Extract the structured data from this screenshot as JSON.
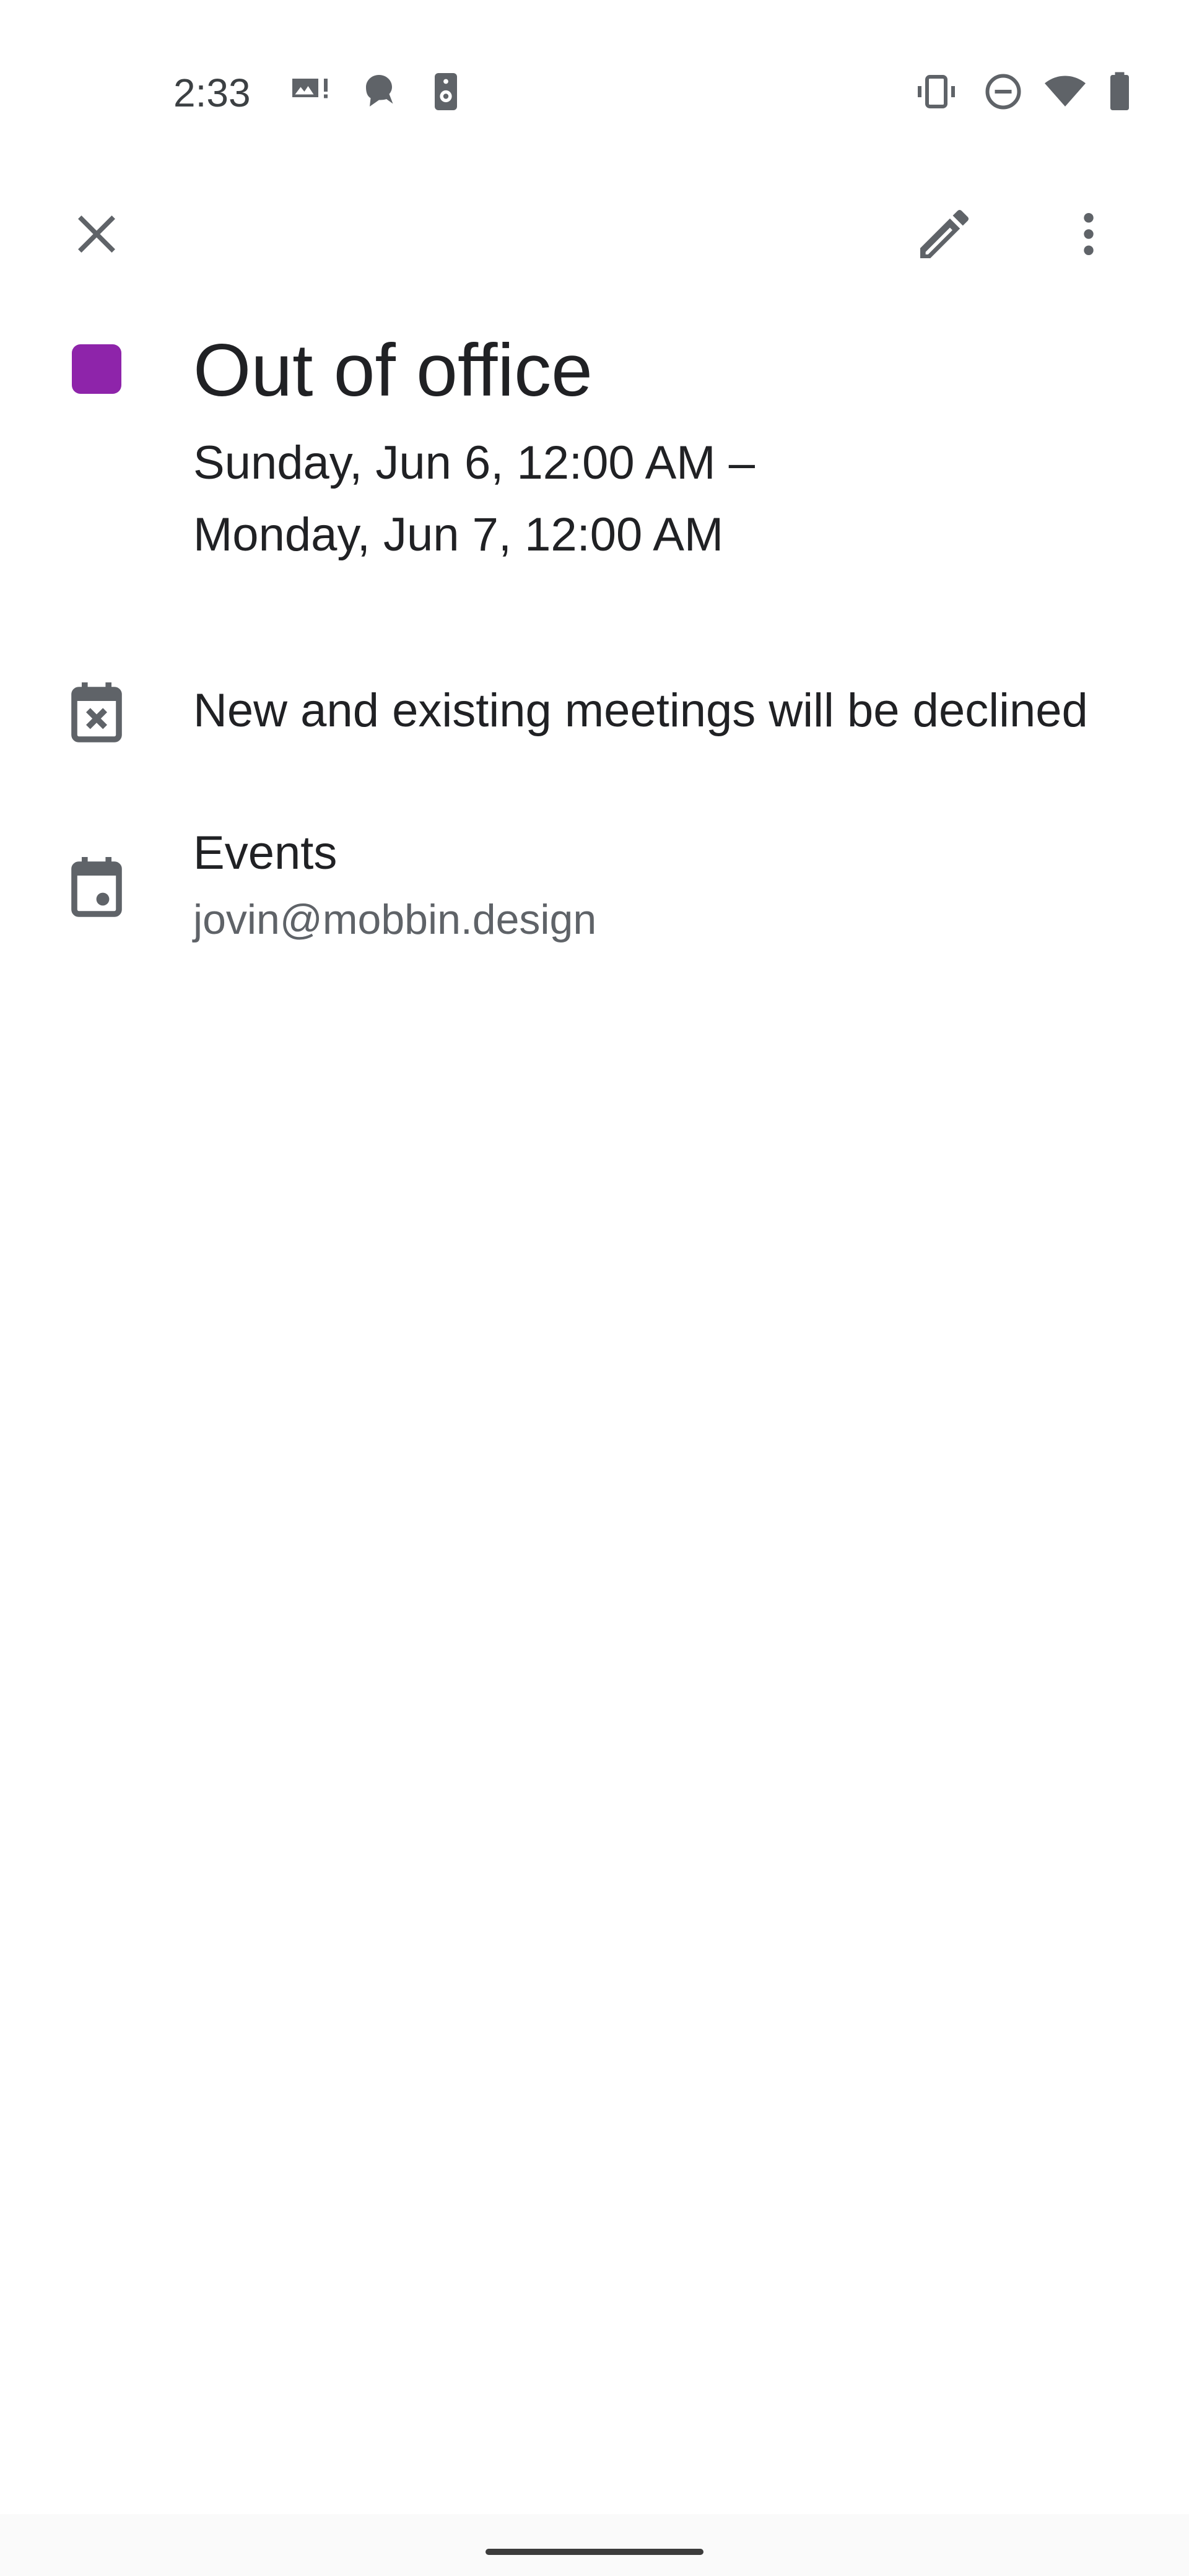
{
  "status_bar": {
    "time": "2:33",
    "left_icons": [
      "image-alert-icon",
      "assistant-icon",
      "speaker-icon"
    ],
    "right_icons": [
      "vibrate-icon",
      "do-not-disturb-icon",
      "wifi-icon",
      "battery-icon"
    ]
  },
  "toolbar": {
    "close_icon": "close-icon",
    "edit_icon": "edit-pencil-icon",
    "more_icon": "more-vert-icon"
  },
  "event": {
    "color": "#8e24aa",
    "title": "Out of office",
    "date_start": "Sunday, Jun 6, 12:00 AM –",
    "date_end": "Monday, Jun 7, 12:00 AM"
  },
  "details": {
    "decline_icon": "calendar-remove-icon",
    "decline_text": "New and existing meetings will be declined",
    "calendar_icon": "calendar-icon",
    "calendar_name": "Events",
    "calendar_account": "jovin@mobbin.design"
  },
  "colors": {
    "icon_gray": "#5f6368",
    "text_primary": "#202124",
    "text_secondary": "#5f6368"
  }
}
